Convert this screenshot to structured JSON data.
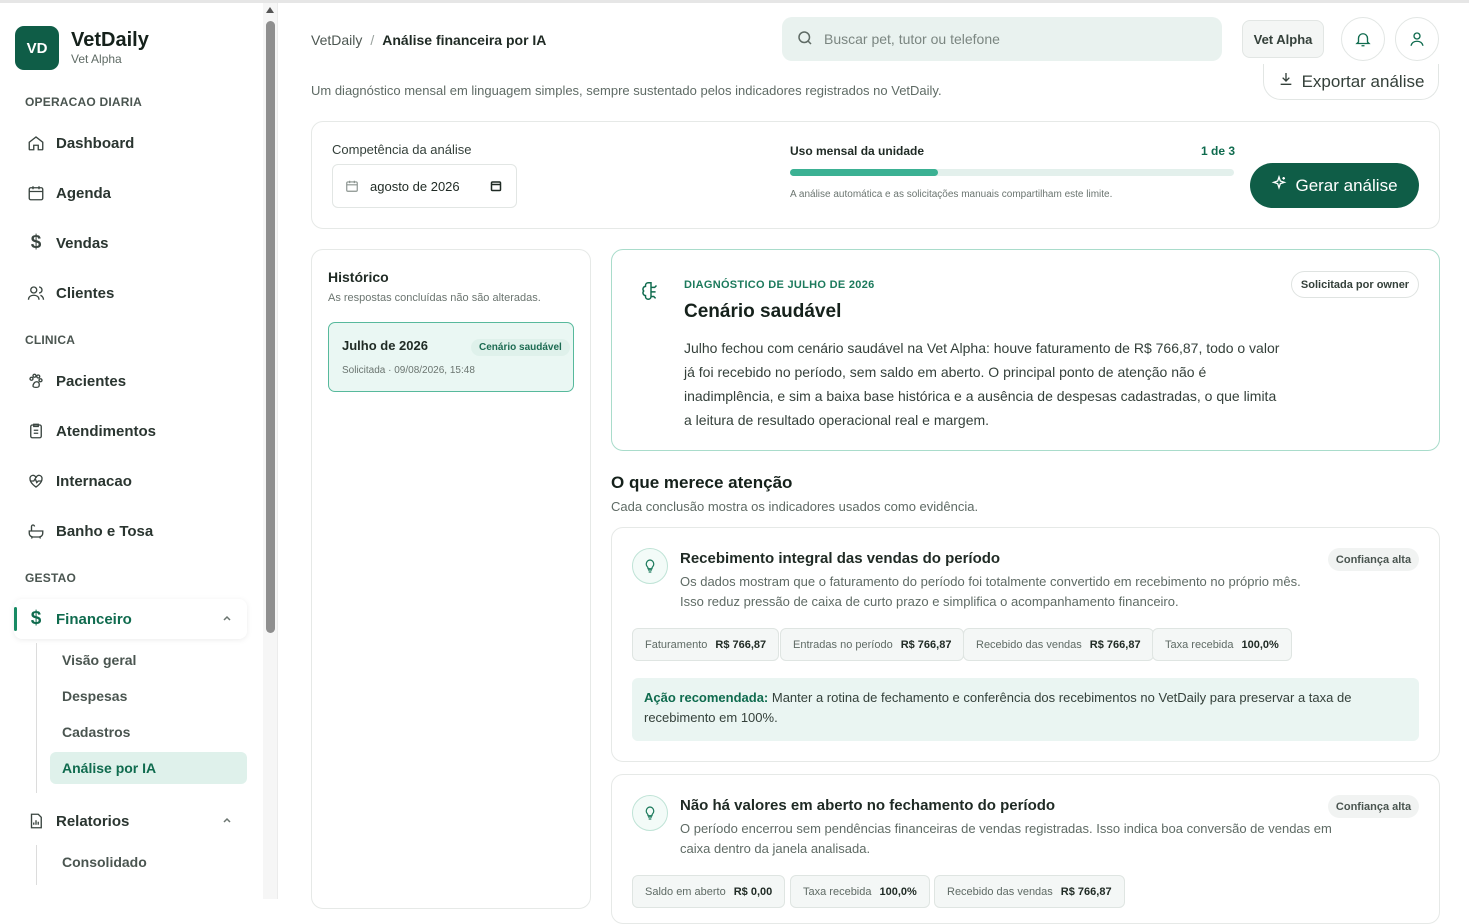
{
  "brand": {
    "logo": "VD",
    "name": "VetDaily",
    "unit": "Vet Alpha"
  },
  "sidebar": {
    "sections": [
      "OPERACAO DIARIA",
      "CLINICA",
      "GESTAO"
    ],
    "items": [
      {
        "label": "Dashboard",
        "icon": "home-icon"
      },
      {
        "label": "Agenda",
        "icon": "calendar-icon"
      },
      {
        "label": "Vendas",
        "icon": "dollar-icon"
      },
      {
        "label": "Clientes",
        "icon": "users-icon"
      },
      {
        "label": "Pacientes",
        "icon": "paw-icon"
      },
      {
        "label": "Atendimentos",
        "icon": "clipboard-icon"
      },
      {
        "label": "Internacao",
        "icon": "heart-pulse-icon"
      },
      {
        "label": "Banho e Tosa",
        "icon": "bath-icon"
      },
      {
        "label": "Financeiro",
        "icon": "dollar-icon"
      },
      {
        "label": "Relatorios",
        "icon": "report-icon"
      }
    ],
    "finance_sub": [
      "Visão geral",
      "Despesas",
      "Cadastros",
      "Análise por IA"
    ],
    "reports_sub": [
      "Consolidado"
    ]
  },
  "header": {
    "breadcrumb_root": "VetDaily",
    "breadcrumb_current": "Análise financeira por IA",
    "search_placeholder": "Buscar pet, tutor ou telefone",
    "unit_button": "Vet Alpha"
  },
  "page": {
    "subtitle": "Um diagnóstico mensal em linguagem simples, sempre sustentado pelos indicadores registrados no VetDaily.",
    "export_label": "Exportar análise"
  },
  "controls": {
    "period_label": "Competência da análise",
    "period_value": "agosto de 2026",
    "usage_label": "Uso mensal da unidade",
    "usage_count": "1 de 3",
    "usage_fraction": 0.333,
    "usage_note": "A análise automática e as solicitações manuais compartilham este limite.",
    "generate_label": "Gerar análise"
  },
  "history": {
    "title": "Histórico",
    "subtitle": "As respostas concluídas não são alteradas.",
    "items": [
      {
        "month": "Julho de 2026",
        "tag": "Cenário saudável",
        "meta": "Solicitada · 09/08/2026, 15:48"
      }
    ]
  },
  "diagnosis": {
    "eyebrow": "DIAGNÓSTICO DE JULHO DE 2026",
    "title": "Cenário saudável",
    "badge": "Solicitada por owner",
    "text": "Julho fechou com cenário saudável na Vet Alpha: houve faturamento de R$ 766,87, todo o valor já foi recebido no período, sem saldo em aberto. O principal ponto de atenção não é inadimplência, e sim a baixa base histórica e a ausência de despesas cadastradas, o que limita a leitura de resultado operacional real e margem."
  },
  "attention": {
    "title": "O que merece atenção",
    "subtitle": "Cada conclusão mostra os indicadores usados como evidência.",
    "cards": [
      {
        "title": "Recebimento integral das vendas do período",
        "confidence": "Confiança alta",
        "body": "Os dados mostram que o faturamento do período foi totalmente convertido em recebimento no próprio mês. Isso reduz pressão de caixa de curto prazo e simplifica o acompanhamento financeiro.",
        "metrics": [
          {
            "label": "Faturamento",
            "value": "R$ 766,87"
          },
          {
            "label": "Entradas no período",
            "value": "R$ 766,87"
          },
          {
            "label": "Recebido das vendas",
            "value": "R$ 766,87"
          },
          {
            "label": "Taxa recebida",
            "value": "100,0%"
          }
        ],
        "action_label": "Ação recomendada:",
        "action_text": " Manter a rotina de fechamento e conferência dos recebimentos no VetDaily para preservar a taxa de recebimento em 100%."
      },
      {
        "title": "Não há valores em aberto no fechamento do período",
        "confidence": "Confiança alta",
        "body": "O período encerrou sem pendências financeiras de vendas registradas. Isso indica boa conversão de vendas em caixa dentro da janela analisada.",
        "metrics": [
          {
            "label": "Saldo em aberto",
            "value": "R$ 0,00"
          },
          {
            "label": "Taxa recebida",
            "value": "100,0%"
          },
          {
            "label": "Recebido das vendas",
            "value": "R$ 766,87"
          }
        ]
      }
    ]
  },
  "colors": {
    "brand": "#0f5d47",
    "accent": "#3bb193",
    "accent_soft": "#dff1eb"
  }
}
